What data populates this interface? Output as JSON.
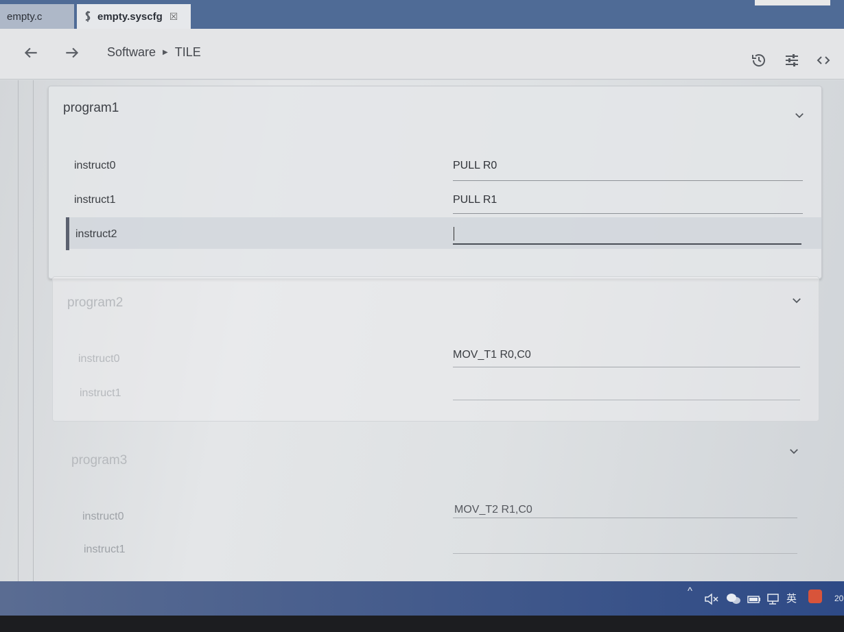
{
  "tabs": [
    {
      "label": "empty.c",
      "active": false
    },
    {
      "label": "empty.syscfg",
      "active": true
    }
  ],
  "tab_close_glyph": "☒",
  "breadcrumb": {
    "items": [
      "Software",
      "TILE"
    ]
  },
  "programs": [
    {
      "title": "program1",
      "rows": [
        {
          "label": "instruct0",
          "value": "PULL R0"
        },
        {
          "label": "instruct1",
          "value": "PULL R1"
        },
        {
          "label": "instruct2",
          "value": ""
        }
      ]
    },
    {
      "title": "program2",
      "rows": [
        {
          "label": "instruct0",
          "value": "MOV_T1 R0,C0"
        },
        {
          "label": "instruct1",
          "value": ""
        }
      ]
    },
    {
      "title": "program3",
      "rows": [
        {
          "label": "instruct0",
          "value": "MOV_T2 R1,C0"
        },
        {
          "label": "instruct1",
          "value": ""
        }
      ]
    }
  ],
  "tray": {
    "ime": "英",
    "clock_fragment": "20"
  },
  "colors": {
    "tabbar": "#4f6b96",
    "accent": "#5b6170",
    "taskbar": "#2e4a86"
  }
}
